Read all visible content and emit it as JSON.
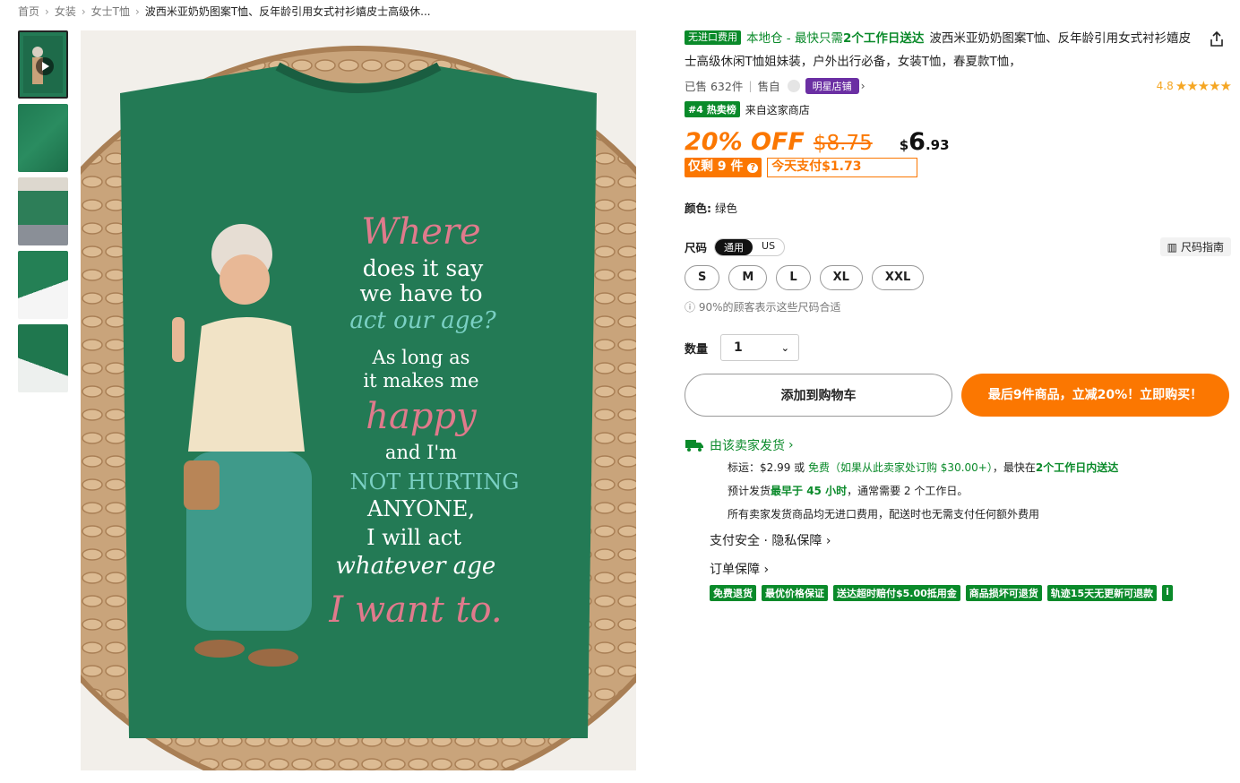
{
  "breadcrumb": [
    "首页",
    "女装",
    "女士T恤",
    "波西米亚奶奶图案T恤、反年龄引用女式衬衫嬉皮士高级休..."
  ],
  "product": {
    "tag": "无进口费用",
    "local_prefix": "本地仓 - 最快只需",
    "local_bold": "2个工作日送达",
    "title": "波西米亚奶奶图案T恤、反年龄引用女式衬衫嬉皮士高级休闲T恤姐妹装，户外出行必备，女装T恤，春夏款T恤，",
    "sold": "已售 632件",
    "self_sold": "售自",
    "store_badge": "明星店铺",
    "rating": "4.8",
    "stars": "★★★★★",
    "rank": "#4 热卖榜",
    "rank_text": "来自这家商店"
  },
  "price": {
    "off": "20% OFF",
    "old": "$8.75",
    "currency": "$",
    "int": "6",
    "dec": ".93",
    "left_badge": "仅剩 9 件",
    "pay_today": "今天支付$1.73"
  },
  "color": {
    "label": "颜色:",
    "value": "绿色"
  },
  "size": {
    "label": "尺码",
    "toggle": [
      "通用",
      "US"
    ],
    "guide": "尺码指南",
    "options": [
      "S",
      "M",
      "L",
      "XL",
      "XXL"
    ],
    "fit_text": "90%的顾客表示这些尺码合适"
  },
  "quantity": {
    "label": "数量",
    "value": "1"
  },
  "buttons": {
    "cart": "添加到购物车",
    "buy": "最后9件商品，立减20%！立即购买！"
  },
  "shipping": {
    "head": "由该卖家发货",
    "line1_a": "标运：$2.99 或 ",
    "line1_free": "免费（如果从此卖家处订购 $30.00+）",
    "line1_b": "，最快在",
    "line1_days": "2个工作日内送达",
    "line2_a": "预计发货",
    "line2_fast": "最早于 45 小时",
    "line2_b": "，通常需要 2 个工作日。",
    "line3": "所有卖家发货商品均无进口费用，配送时也无需支付任何额外费用",
    "privacy": "支付安全 · 隐私保障",
    "order": "订单保障"
  },
  "guarantees": [
    "免费退货",
    "最优价格保证",
    "送达超时赔付$5.00抵用金",
    "商品损坏可退货",
    "轨迹15天无更新可退款",
    "i"
  ],
  "image_text": [
    "Where",
    "does it say",
    "we have to",
    "act our age?",
    "As long as",
    "it makes me",
    "happy",
    "and I'm",
    "NOT HURTING",
    "ANYONE,",
    "I will act",
    "whatever age",
    "I want to."
  ],
  "colors": {
    "accent": "#fb7701",
    "green": "#0a8a2a",
    "shirt": "#237a55",
    "purple": "#6b2fa3"
  }
}
